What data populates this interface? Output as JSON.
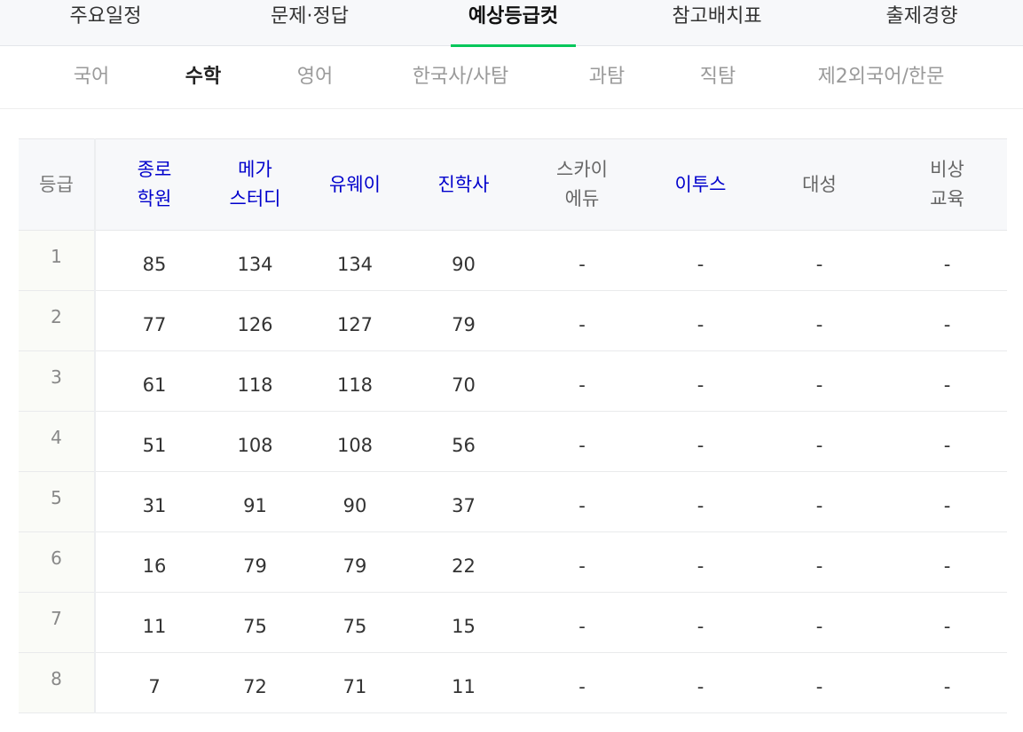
{
  "top_tabs": [
    {
      "label": "주요일정"
    },
    {
      "label": "문제·정답"
    },
    {
      "label": "예상등급컷"
    },
    {
      "label": "참고배치표"
    },
    {
      "label": "출제경향"
    }
  ],
  "active_top_tab": "예상등급컷",
  "subject_tabs": [
    {
      "label": "국어"
    },
    {
      "label": "수학"
    },
    {
      "label": "영어"
    },
    {
      "label": "한국사/사탐"
    },
    {
      "label": "과탐"
    },
    {
      "label": "직탐"
    },
    {
      "label": "제2외국어/한문"
    }
  ],
  "active_subject_tab": "수학",
  "table": {
    "grade_header": "등급",
    "providers": [
      {
        "label": "종로\n학원",
        "linked": true
      },
      {
        "label": "메가\n스터디",
        "linked": true
      },
      {
        "label": "유웨이",
        "linked": true
      },
      {
        "label": "진학사",
        "linked": true
      },
      {
        "label": "스카이\n에듀",
        "linked": false
      },
      {
        "label": "이투스",
        "linked": true
      },
      {
        "label": "대성",
        "linked": false
      },
      {
        "label": "비상\n교육",
        "linked": false
      }
    ],
    "rows": [
      {
        "grade": "1",
        "cells": [
          "85",
          "134",
          "134",
          "90",
          "-",
          "-",
          "-",
          "-"
        ]
      },
      {
        "grade": "2",
        "cells": [
          "77",
          "126",
          "127",
          "79",
          "-",
          "-",
          "-",
          "-"
        ]
      },
      {
        "grade": "3",
        "cells": [
          "61",
          "118",
          "118",
          "70",
          "-",
          "-",
          "-",
          "-"
        ]
      },
      {
        "grade": "4",
        "cells": [
          "51",
          "108",
          "108",
          "56",
          "-",
          "-",
          "-",
          "-"
        ]
      },
      {
        "grade": "5",
        "cells": [
          "31",
          "91",
          "90",
          "37",
          "-",
          "-",
          "-",
          "-"
        ]
      },
      {
        "grade": "6",
        "cells": [
          "16",
          "79",
          "79",
          "22",
          "-",
          "-",
          "-",
          "-"
        ]
      },
      {
        "grade": "7",
        "cells": [
          "11",
          "75",
          "75",
          "15",
          "-",
          "-",
          "-",
          "-"
        ]
      },
      {
        "grade": "8",
        "cells": [
          "7",
          "72",
          "71",
          "11",
          "-",
          "-",
          "-",
          "-"
        ]
      }
    ]
  },
  "colors": {
    "accent_underline": "#03c75a",
    "link_text": "#0000cc",
    "header_bg": "#f7f8fa"
  }
}
